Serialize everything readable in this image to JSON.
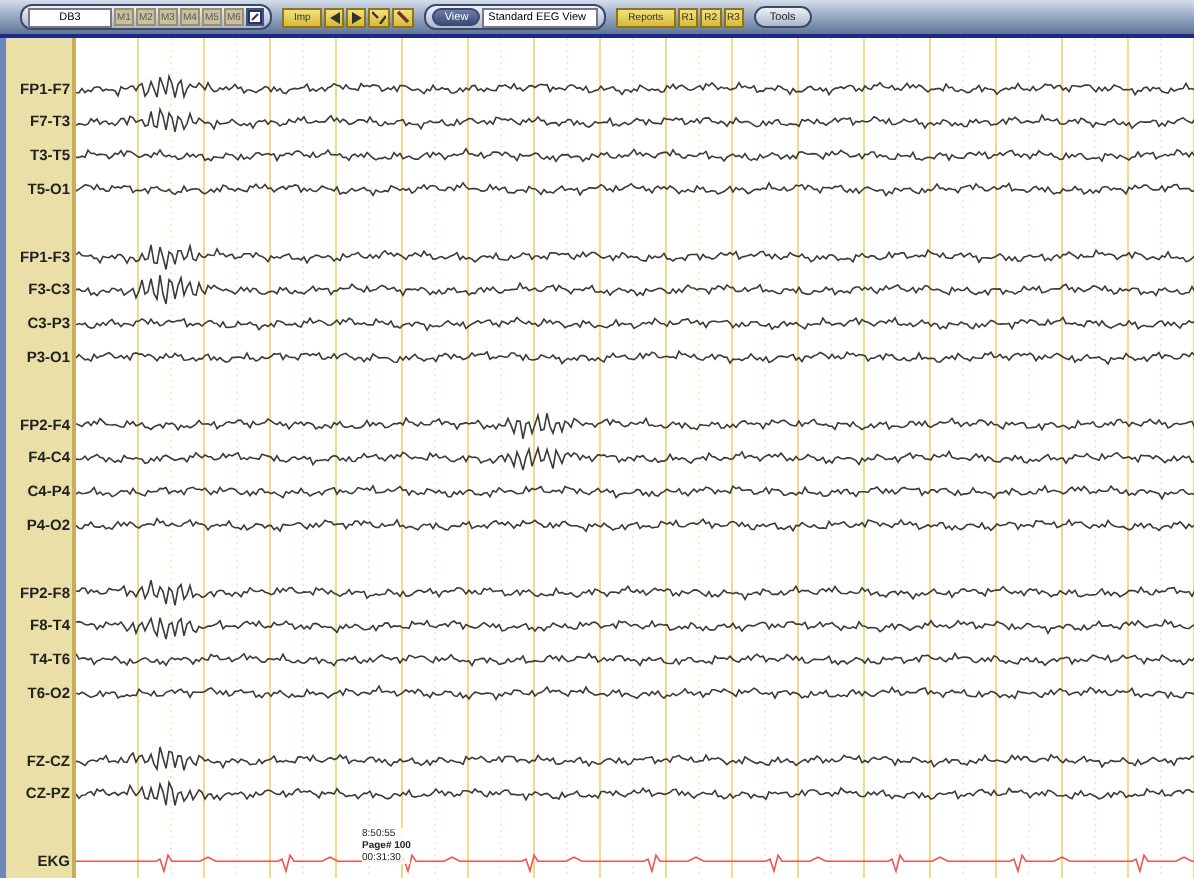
{
  "toolbar": {
    "study_field": "DB3",
    "montage_buttons": [
      "M1",
      "M2",
      "M3",
      "M4",
      "M5",
      "M6"
    ],
    "imp_button": "Imp",
    "view_button": "View",
    "view_field": "Standard EEG View",
    "reports_button": "Reports",
    "report_buttons": [
      "R1",
      "R2",
      "R3"
    ],
    "tools_button": "Tools"
  },
  "channel_groups": [
    {
      "channels": [
        "FP1-F7",
        "F7-T3",
        "T3-T5",
        "T5-O1"
      ]
    },
    {
      "channels": [
        "FP1-F3",
        "F3-C3",
        "C3-P3",
        "P3-O1"
      ]
    },
    {
      "channels": [
        "FP2-F4",
        "F4-C4",
        "C4-P4",
        "P4-O2"
      ]
    },
    {
      "channels": [
        "FP2-F8",
        "F8-T4",
        "T4-T6",
        "T6-O2"
      ]
    },
    {
      "channels": [
        "FZ-CZ",
        "CZ-PZ"
      ]
    }
  ],
  "ekg": {
    "label": "EKG"
  },
  "page_marker": {
    "time": "8:50:55",
    "page": "Page# 100",
    "elapsed": "00:31:30"
  }
}
